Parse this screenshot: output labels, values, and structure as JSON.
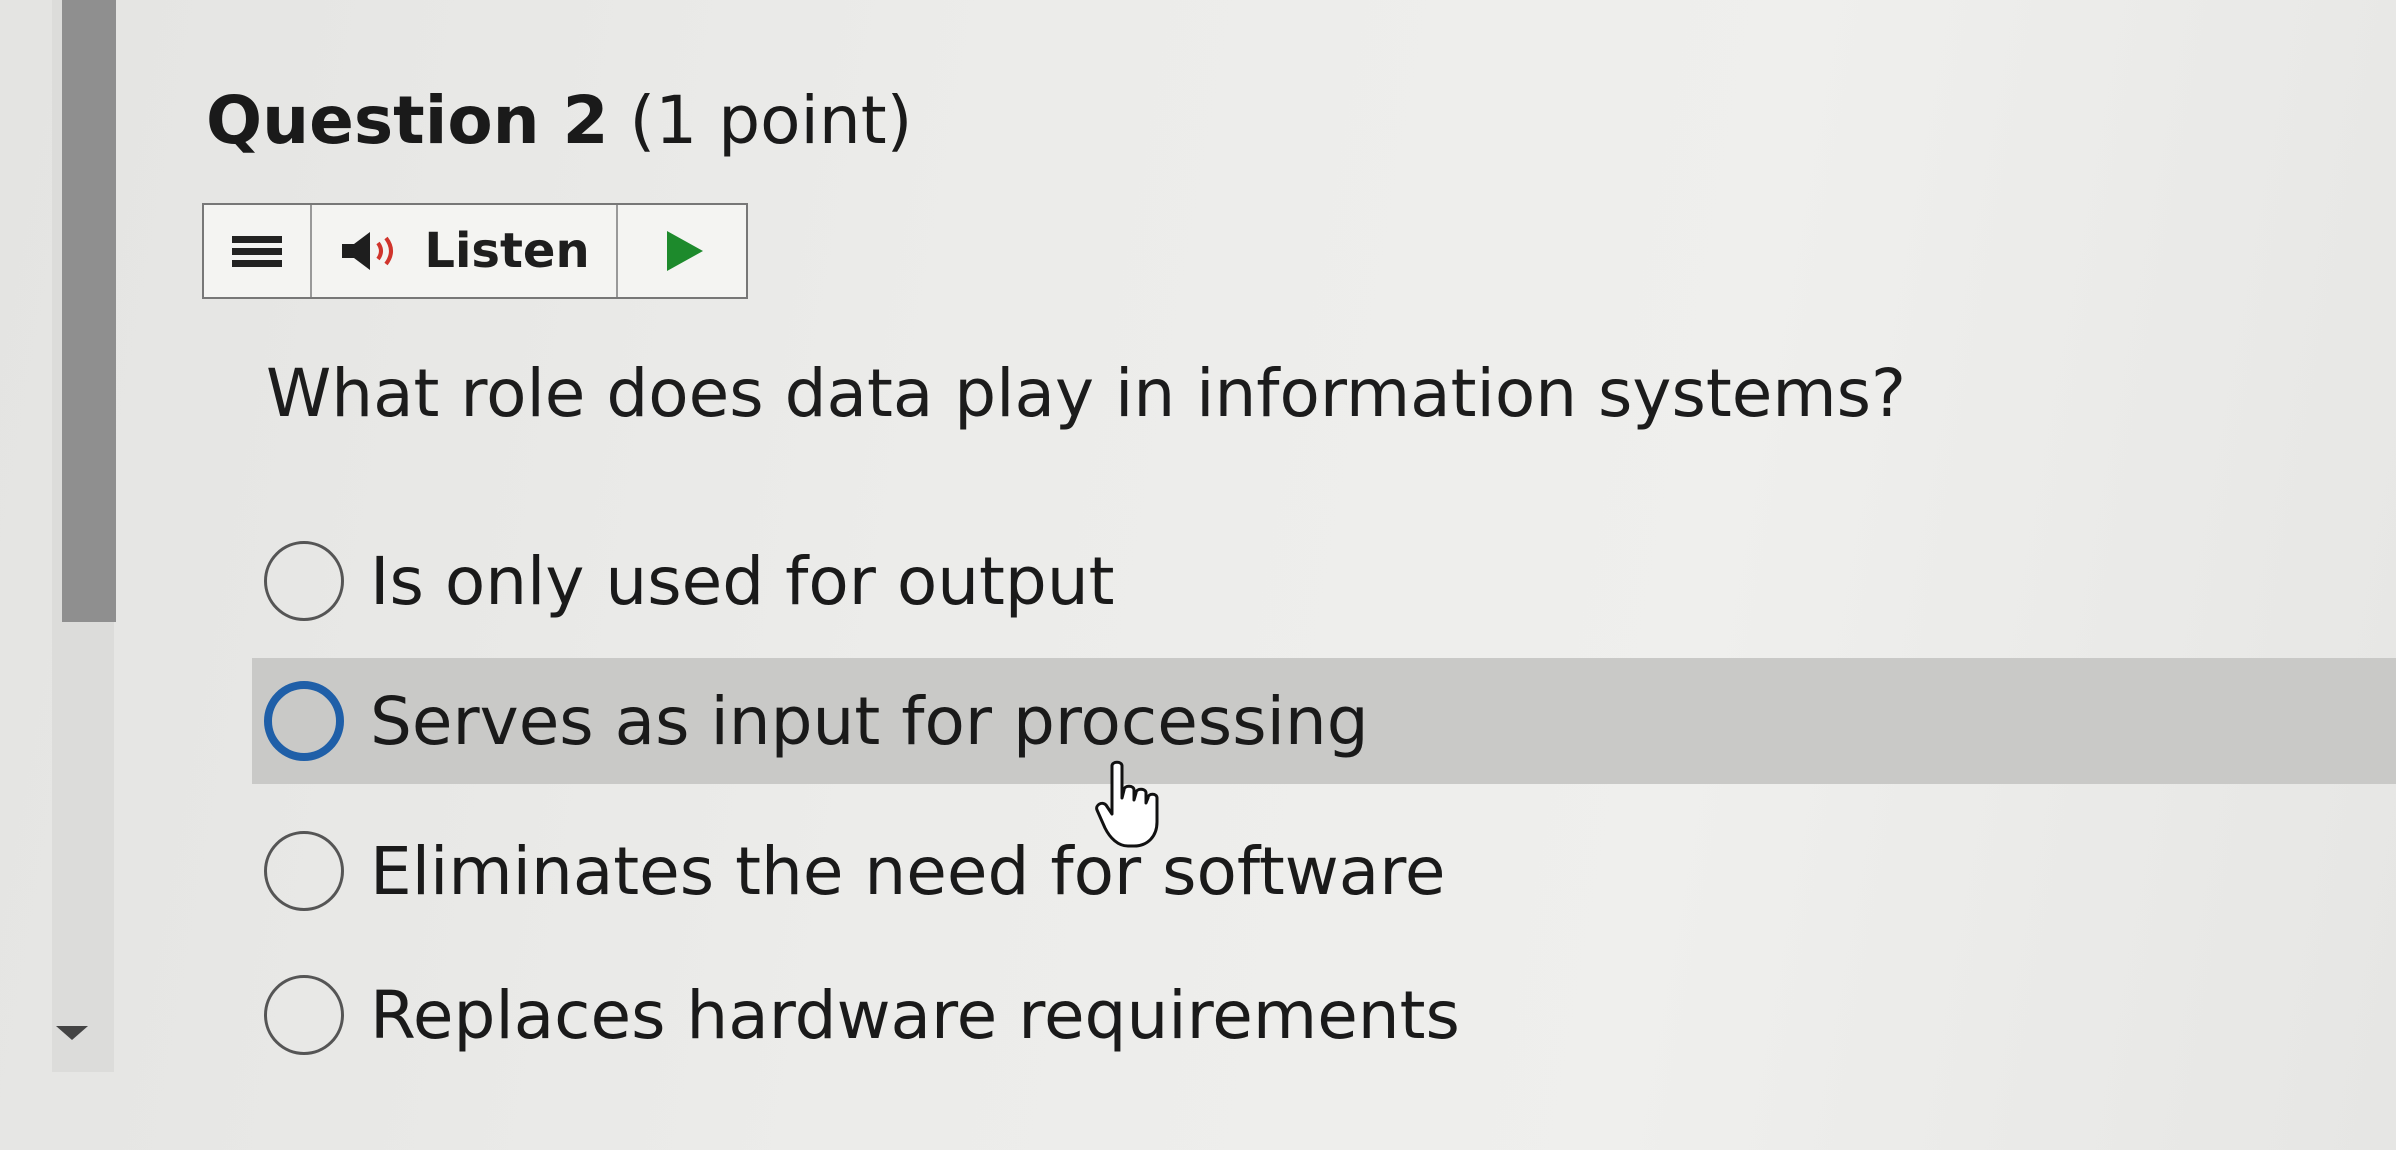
{
  "question": {
    "number_label": "Question 2",
    "points_label": "(1 point)",
    "text": "What role does data play in information systems?"
  },
  "toolbar": {
    "menu_icon": "menu-icon",
    "listen_label": "Listen",
    "speaker_icon": "speaker-icon",
    "play_icon": "play-icon",
    "play_color": "#1d8a2c",
    "speaker_wave_color": "#d0342c"
  },
  "options": [
    {
      "label": "Is only used for output",
      "hovered": false
    },
    {
      "label": "Serves as input for processing",
      "hovered": true
    },
    {
      "label": "Eliminates the need for software",
      "hovered": false
    },
    {
      "label": "Replaces hardware requirements",
      "hovered": false
    }
  ],
  "colors": {
    "hover_row": "#c9c9c7",
    "radio_focus": "#1f5fa8"
  }
}
